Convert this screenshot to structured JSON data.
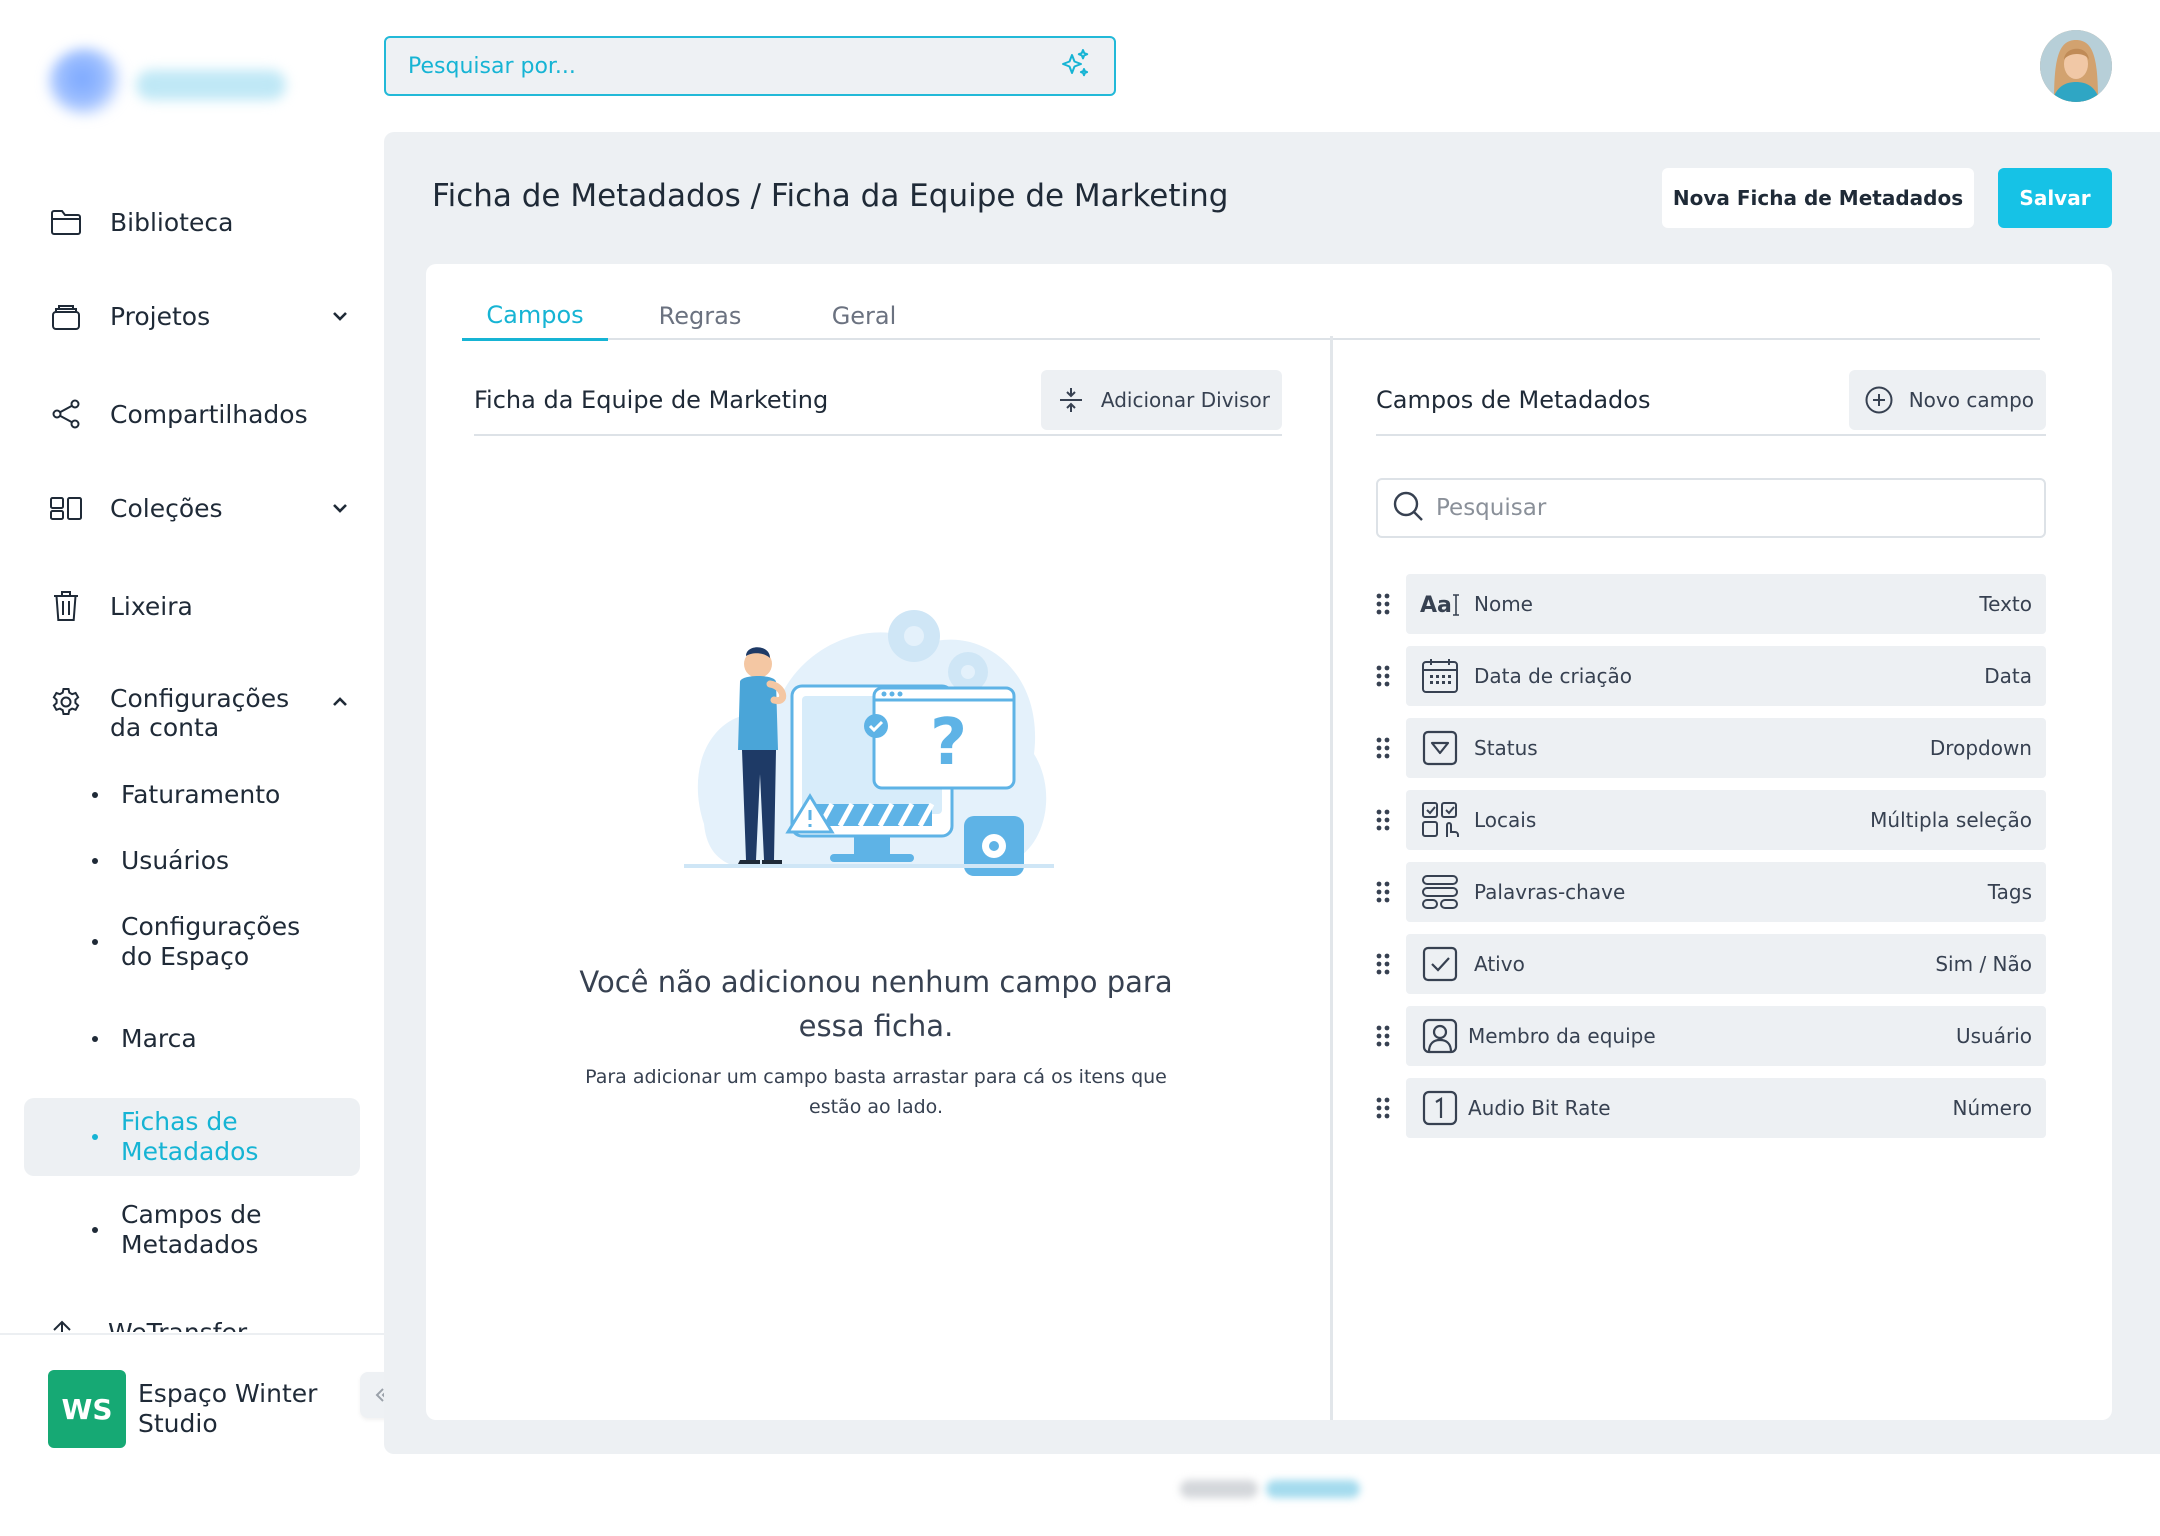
{
  "search": {
    "placeholder": "Pesquisar por..."
  },
  "sidebar": {
    "items": [
      {
        "label": "Biblioteca",
        "icon": "folder-icon"
      },
      {
        "label": "Projetos",
        "icon": "stack-icon"
      },
      {
        "label": "Compartilhados",
        "icon": "share-icon"
      },
      {
        "label": "Coleções",
        "icon": "collections-icon"
      },
      {
        "label": "Lixeira",
        "icon": "trash-icon"
      },
      {
        "label": "Configurações da conta",
        "icon": "gear-icon"
      }
    ],
    "subitems": [
      {
        "label": "Faturamento"
      },
      {
        "label": "Usuários"
      },
      {
        "label": "Configurações do Espaço"
      },
      {
        "label": "Marca"
      },
      {
        "label": "Fichas de Metadados"
      },
      {
        "label": "Campos de Metadados"
      }
    ],
    "cut_item": {
      "label": "WeTransfer"
    },
    "workspace": {
      "initials": "WS",
      "name": "Espaço Winter Studio"
    }
  },
  "header": {
    "title": "Ficha de Metadados / Ficha da Equipe de Marketing",
    "new_sheet_label": "Nova Ficha de Metadados",
    "save_label": "Salvar"
  },
  "tabs": [
    {
      "label": "Campos"
    },
    {
      "label": "Regras"
    },
    {
      "label": "Geral"
    }
  ],
  "left_panel": {
    "title": "Ficha da Equipe de Marketing",
    "add_divider_label": "Adicionar Divisor",
    "empty_title": "Você não adicionou nenhum campo para essa ficha.",
    "empty_subtitle": "Para adicionar um campo basta arrastar para cá os itens que estão ao lado."
  },
  "right_panel": {
    "title": "Campos de Metadados",
    "new_field_label": "Novo campo",
    "search_placeholder": "Pesquisar",
    "fields": [
      {
        "name": "Nome",
        "type": "Texto",
        "icon": "text-icon"
      },
      {
        "name": "Data de criação",
        "type": "Data",
        "icon": "calendar-icon"
      },
      {
        "name": "Status",
        "type": "Dropdown",
        "icon": "dropdown-icon"
      },
      {
        "name": "Locais",
        "type": "Múltipla seleção",
        "icon": "multi-select-icon"
      },
      {
        "name": "Palavras-chave",
        "type": "Tags",
        "icon": "tags-icon"
      },
      {
        "name": "Ativo",
        "type": "Sim / Não",
        "icon": "checkbox-icon"
      },
      {
        "name": "Membro da equipe",
        "type": "Usuário",
        "icon": "user-icon"
      },
      {
        "name": "Audio Bit Rate",
        "type": "Número",
        "icon": "number-icon"
      }
    ]
  },
  "colors": {
    "accent": "#16b4d4",
    "primary_button": "#16c2e6",
    "workspace": "#16a974",
    "panel_bg": "#edf0f3"
  }
}
